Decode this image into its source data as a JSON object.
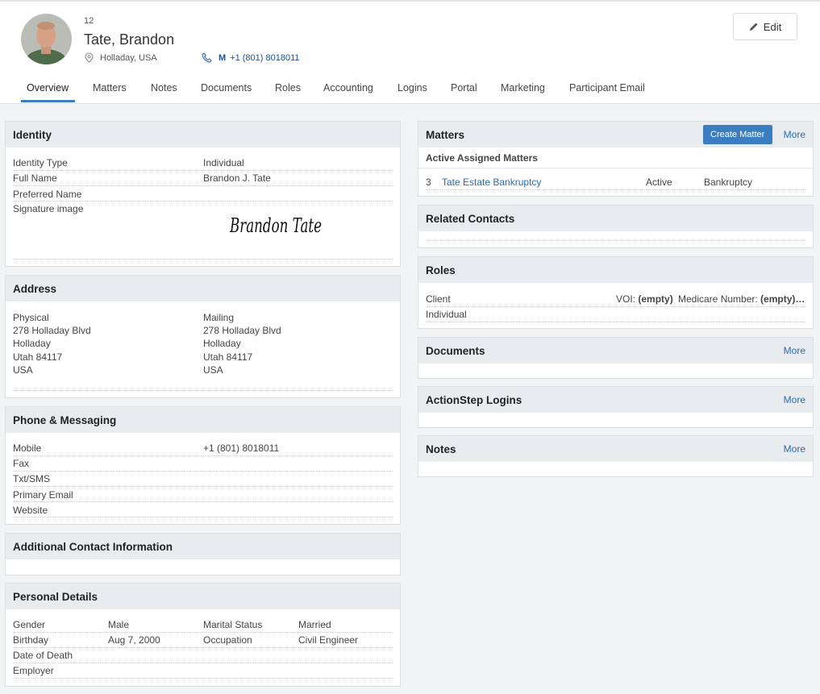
{
  "contact": {
    "id": "12",
    "name": "Tate, Brandon",
    "location": "Holladay, USA",
    "phone_type": "M",
    "phone": "+1 (801) 8018011",
    "edit_label": "Edit"
  },
  "tabs": [
    "Overview",
    "Matters",
    "Notes",
    "Documents",
    "Roles",
    "Accounting",
    "Logins",
    "Portal",
    "Marketing",
    "Participant Email"
  ],
  "identity": {
    "title": "Identity",
    "rows": [
      {
        "label": "Identity Type",
        "value": "Individual"
      },
      {
        "label": "Full Name",
        "value": "Brandon J. Tate"
      },
      {
        "label": "Preferred Name",
        "value": ""
      },
      {
        "label": "Signature image",
        "value": ""
      }
    ],
    "signature": "Brandon Tate"
  },
  "address": {
    "title": "Address",
    "physical": [
      "Physical",
      "278 Holladay Blvd",
      "Holladay",
      "Utah 84117",
      "USA"
    ],
    "mailing": [
      "Mailing",
      "278 Holladay Blvd",
      "Holladay",
      "Utah 84117",
      "USA"
    ]
  },
  "phone_messaging": {
    "title": "Phone & Messaging",
    "rows": [
      {
        "label": "Mobile",
        "value": "+1 (801) 8018011"
      },
      {
        "label": "Fax",
        "value": ""
      },
      {
        "label": "Txt/SMS",
        "value": ""
      },
      {
        "label": "Primary Email",
        "value": ""
      },
      {
        "label": "Website",
        "value": ""
      }
    ]
  },
  "additional": {
    "title": "Additional Contact Information"
  },
  "personal": {
    "title": "Personal Details",
    "rows": [
      {
        "l1": "Gender",
        "v1": "Male",
        "l2": "Marital Status",
        "v2": "Married"
      },
      {
        "l1": "Birthday",
        "v1": "Aug 7, 2000",
        "l2": "Occupation",
        "v2": "Civil Engineer"
      },
      {
        "l1": "Date of Death",
        "v1": "",
        "l2": "",
        "v2": ""
      },
      {
        "l1": "Employer",
        "v1": "",
        "l2": "",
        "v2": ""
      }
    ]
  },
  "matters": {
    "title": "Matters",
    "create_label": "Create Matter",
    "more_label": "More",
    "subheading": "Active Assigned Matters",
    "items": [
      {
        "num": "3",
        "name": "Tate Estate Bankruptcy",
        "status": "Active",
        "type": "Bankruptcy"
      }
    ]
  },
  "related": {
    "title": "Related Contacts"
  },
  "roles": {
    "title": "Roles",
    "role": "Client",
    "voi_label": "VOI:",
    "voi_value": "(empty)",
    "medicare_label": "Medicare Number:",
    "medicare_value": "(empty)…",
    "type": "Individual"
  },
  "documents": {
    "title": "Documents",
    "more_label": "More"
  },
  "logins": {
    "title": "ActionStep Logins",
    "more_label": "More"
  },
  "notes": {
    "title": "Notes",
    "more_label": "More"
  },
  "colors": {
    "accent": "#3a7dc1",
    "link": "#2a6ab1",
    "panel_head": "#e9ecef"
  }
}
